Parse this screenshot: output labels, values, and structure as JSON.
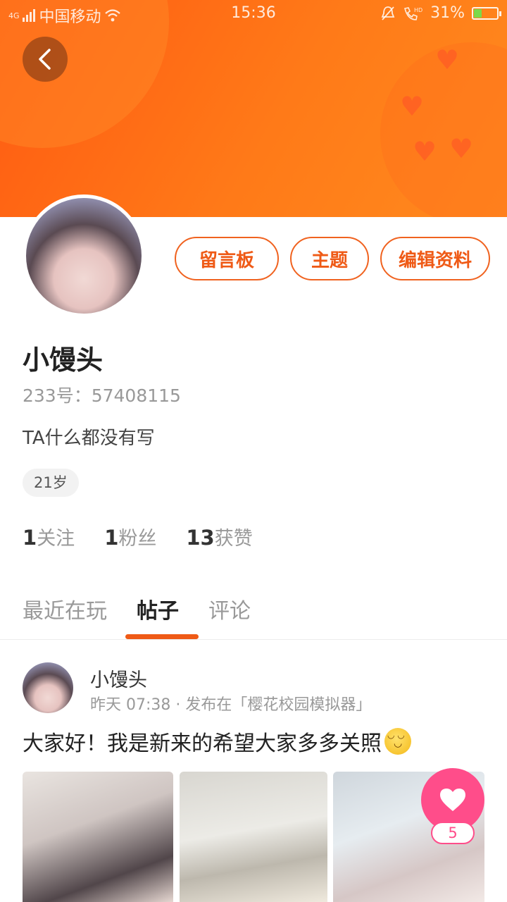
{
  "status_bar": {
    "signal_tag": "4G",
    "carrier": "中国移动",
    "time": "15:36",
    "battery": "31%",
    "battery_level": 0.31
  },
  "profile": {
    "name": "小馒头",
    "uid": "233号：57408115",
    "bio": "TA什么都没有写",
    "age_tag": "21岁",
    "buttons": {
      "message_board": "留言板",
      "theme": "主题",
      "edit_profile": "编辑资料"
    },
    "stats": {
      "following_count": "1",
      "following_label": "关注",
      "fans_count": "1",
      "fans_label": "粉丝",
      "likes_count": "13",
      "likes_label": "获赞"
    }
  },
  "tabs": [
    {
      "label": "最近在玩",
      "active": false
    },
    {
      "label": "帖子",
      "active": true
    },
    {
      "label": "评论",
      "active": false
    }
  ],
  "post": {
    "author": "小馒头",
    "meta": "昨天 07:38 · 发布在「樱花校园模拟器」",
    "text": "大家好！我是新来的希望大家多多关照",
    "like_count": "5"
  },
  "colors": {
    "accent": "#ef5a16",
    "header_gradient_start": "#ff5a12",
    "header_gradient_end": "#ff8a1e",
    "like_pink": "#ff4d8a"
  }
}
